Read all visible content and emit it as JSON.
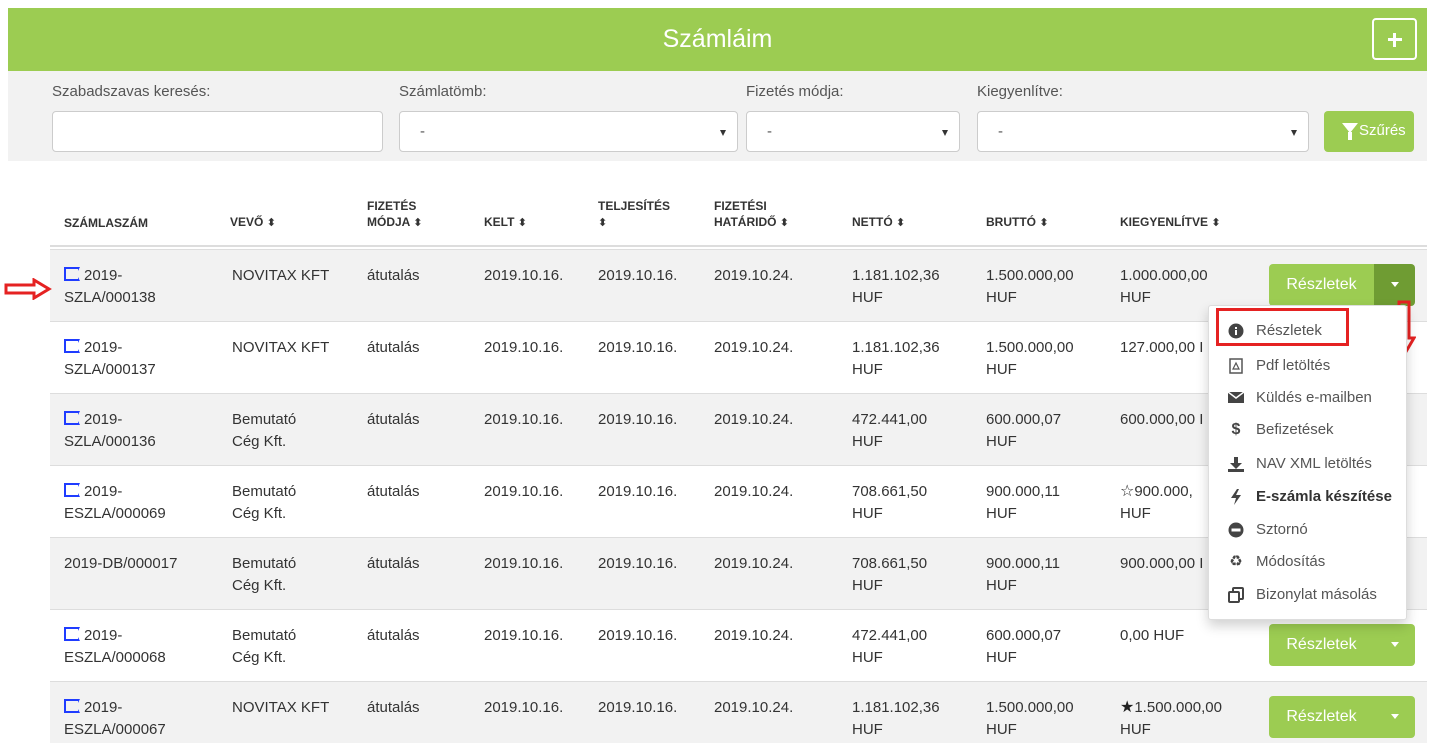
{
  "header": {
    "title": "Számláim",
    "add_label": "+"
  },
  "filters": {
    "search_label": "Szabadszavas keresés:",
    "search_value": "",
    "szamlatomb_label": "Számlatömb:",
    "szamlatomb_value": "-",
    "fizetes_label": "Fizetés módja:",
    "fizetes_value": "-",
    "kiegyenlitve_label": "Kiegyenlítve:",
    "kiegyenlitve_value": "-",
    "filter_button": "Szűrés"
  },
  "table": {
    "headers": {
      "szamlaszam": "SZÁMLASZÁM",
      "vevo": "VEVŐ",
      "fizetes_1": "FIZETÉS",
      "fizetes_2": "MÓDJA",
      "kelt": "KELT",
      "teljesites": "TELJESÍTÉS",
      "hatarido_1": "FIZETÉSI",
      "hatarido_2": "HATÁRIDŐ",
      "netto": "NETTÓ",
      "brutto": "BRUTTÓ",
      "kiegyenlitve": "KIEGYENLÍTVE",
      "sort_icon": "⬍"
    },
    "rows": [
      {
        "num1": "2019-",
        "num2": "SZLA/000138",
        "vevo1": "NOVITAX KFT",
        "vevo2": "",
        "mod": "átutalás",
        "kelt": "2019.10.16.",
        "telj": "2019.10.16.",
        "hat": "2019.10.24.",
        "netto1": "1.181.102,36",
        "netto2": "HUF",
        "brutto1": "1.500.000,00",
        "brutto2": "HUF",
        "kieg1": "1.000.000,00",
        "kieg2": "HUF",
        "button": "Részletek"
      },
      {
        "num1": "2019-",
        "num2": "SZLA/000137",
        "vevo1": "NOVITAX KFT",
        "vevo2": "",
        "mod": "átutalás",
        "kelt": "2019.10.16.",
        "telj": "2019.10.16.",
        "hat": "2019.10.24.",
        "netto1": "1.181.102,36",
        "netto2": "HUF",
        "brutto1": "1.500.000,00",
        "brutto2": "HUF",
        "kieg1": "127.000,00 I",
        "kieg2": ""
      },
      {
        "num1": "2019-",
        "num2": "SZLA/000136",
        "vevo1": "Bemutató",
        "vevo2": "Cég Kft.",
        "mod": "átutalás",
        "kelt": "2019.10.16.",
        "telj": "2019.10.16.",
        "hat": "2019.10.24.",
        "netto1": "472.441,00",
        "netto2": "HUF",
        "brutto1": "600.000,07",
        "brutto2": "HUF",
        "kieg1": "600.000,00 I",
        "kieg2": ""
      },
      {
        "num1": "2019-",
        "num2": "ESZLA/000069",
        "vevo1": "Bemutató",
        "vevo2": "Cég Kft.",
        "mod": "átutalás",
        "kelt": "2019.10.16.",
        "telj": "2019.10.16.",
        "hat": "2019.10.24.",
        "netto1": "708.661,50",
        "netto2": "HUF",
        "brutto1": "900.000,11",
        "brutto2": "HUF",
        "kieg1": "900.000,",
        "kieg2": "HUF"
      },
      {
        "num1": "2019-DB/000017",
        "num2": "",
        "vevo1": "Bemutató",
        "vevo2": "Cég Kft.",
        "mod": "átutalás",
        "kelt": "2019.10.16.",
        "telj": "2019.10.16.",
        "hat": "2019.10.24.",
        "netto1": "708.661,50",
        "netto2": "HUF",
        "brutto1": "900.000,11",
        "brutto2": "HUF",
        "kieg1": "900.000,00 I",
        "kieg2": ""
      },
      {
        "num1": "2019-",
        "num2": "ESZLA/000068",
        "vevo1": "Bemutató",
        "vevo2": "Cég Kft.",
        "mod": "átutalás",
        "kelt": "2019.10.16.",
        "telj": "2019.10.16.",
        "hat": "2019.10.24.",
        "netto1": "472.441,00",
        "netto2": "HUF",
        "brutto1": "600.000,07",
        "brutto2": "HUF",
        "kieg1": "0,00 HUF",
        "kieg2": "",
        "button": "Részletek"
      },
      {
        "num1": "2019-",
        "num2": "ESZLA/000067",
        "vevo1": "NOVITAX KFT",
        "vevo2": "",
        "mod": "átutalás",
        "kelt": "2019.10.16.",
        "telj": "2019.10.16.",
        "hat": "2019.10.24.",
        "netto1": "1.181.102,36",
        "netto2": "HUF",
        "brutto1": "1.500.000,00",
        "brutto2": "HUF",
        "kieg1": "1.500.000,00",
        "kieg2": "HUF",
        "button": "Részletek"
      }
    ]
  },
  "menu": {
    "items": [
      "Részletek",
      "Pdf letöltés",
      "Küldés e-mailben",
      "Befizetések",
      "NAV XML letöltés",
      "E-számla készítése",
      "Sztornó",
      "Módosítás",
      "Bizonylat másolás"
    ],
    "icons": [
      "info-icon",
      "pdf-icon",
      "envelope-icon",
      "dollar-icon",
      "download-icon",
      "bolt-icon",
      "minus-circle-icon",
      "recycle-icon",
      "copy-icon"
    ]
  },
  "colors": {
    "accent": "#9ccc52",
    "flag": "#1f3cff",
    "highlight": "#e52222"
  }
}
